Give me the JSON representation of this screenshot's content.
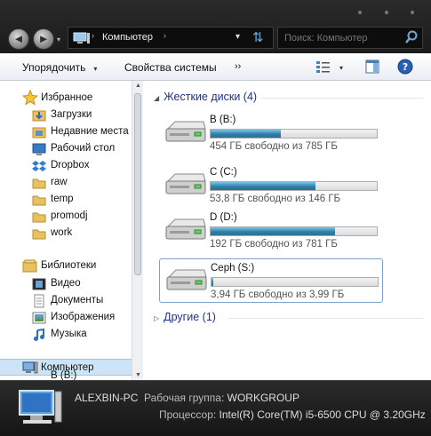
{
  "titlebar": {
    "address": {
      "text": "Компьютер",
      "separator": "›",
      "dropdown": "▾"
    },
    "search": {
      "placeholder": "Поиск: Компьютер"
    },
    "back_label": "◄",
    "forward_label": "►",
    "history_dropdown": "▾"
  },
  "toolbar": {
    "organize": "Упорядочить",
    "system_properties": "Свойства системы",
    "more": "››",
    "caret": "▾"
  },
  "nav": {
    "favorites_header": "Избранное",
    "favorites": [
      "Загрузки",
      "Недавние места",
      "Рабочий стол",
      "Dropbox",
      "raw",
      "temp",
      "promodj",
      "work"
    ],
    "libraries_header": "Библиотеки",
    "libraries": [
      "Видео",
      "Документы",
      "Изображения",
      "Музыка"
    ],
    "computer": "Компьютер",
    "partial_item": "B (B:)"
  },
  "content": {
    "hard_drives_header": "Жесткие диски (4)",
    "other_header": "Другие (1)",
    "drives": [
      {
        "name": "B (B:)",
        "free_text": "454 ГБ свободно из 785 ГБ",
        "used_fraction": 0.42
      },
      {
        "name": "C (C:)",
        "free_text": "53,8 ГБ свободно из 146 ГБ",
        "used_fraction": 0.63
      },
      {
        "name": "D (D:)",
        "free_text": "192 ГБ свободно из 781 ГБ",
        "used_fraction": 0.75
      },
      {
        "name": "Ceph (S:)",
        "free_text": "3,94 ГБ свободно из 3,99 ГБ",
        "used_fraction": 0.012
      }
    ]
  },
  "details": {
    "pc_name": "ALEXBIN-PC",
    "workgroup_label": "Рабочая группа:",
    "workgroup": "WORKGROUP",
    "cpu_label": "Процессор:",
    "cpu": "Intel(R) Core(TM) i5-6500 CPU @ 3.20GHz"
  },
  "colors": {
    "accent": "#1e3287",
    "bar_fill": "#2f7fa8",
    "selection": "#cde4f7"
  }
}
